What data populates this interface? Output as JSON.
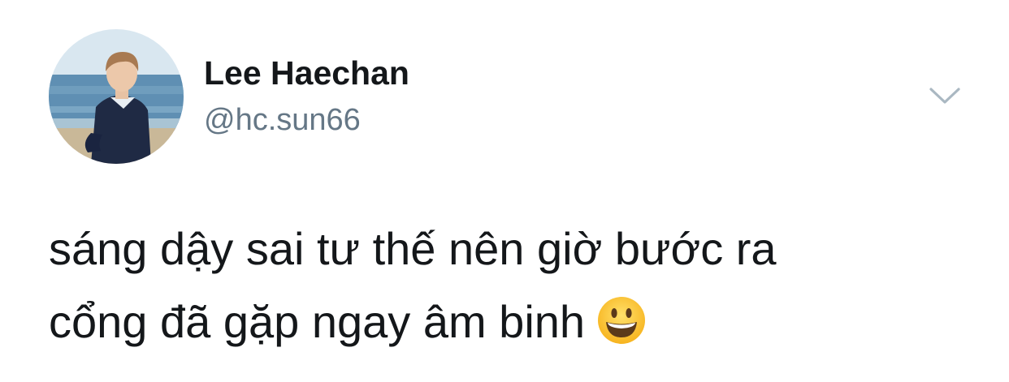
{
  "tweet": {
    "author": {
      "display_name": "Lee Haechan",
      "handle": "@hc.sun66",
      "avatar_icon": "profile-photo-beach"
    },
    "menu_icon": "chevron-down-icon",
    "text_lines": [
      "sáng dậy sai tư thế nên giờ bước ra",
      "cổng đã gặp ngay âm binh"
    ],
    "emoji_icon": "grinning-face-emoji"
  },
  "colors": {
    "name": "#14171a",
    "handle": "#657786",
    "chevron": "#aab8c2",
    "background": "#ffffff"
  }
}
